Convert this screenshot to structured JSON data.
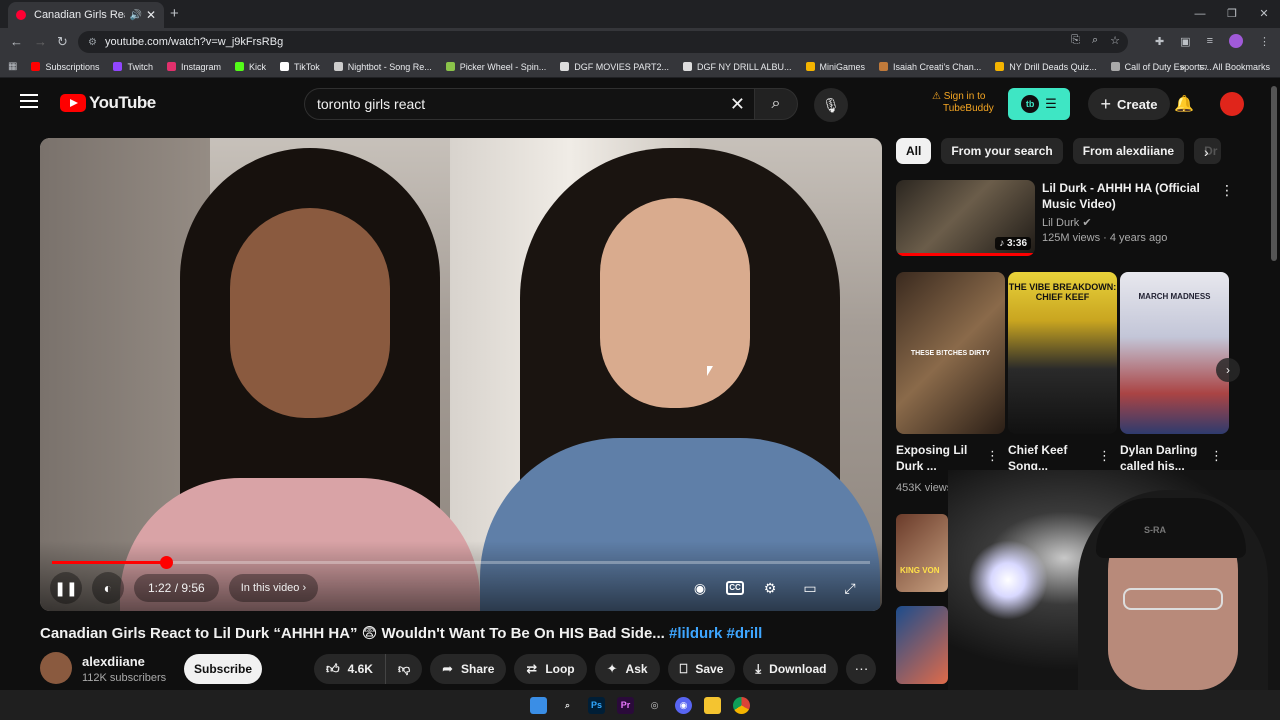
{
  "browser": {
    "tab_title": "Canadian Girls React to Lil Durk",
    "url": "youtube.com/watch?v=w_j9kFrsRBg",
    "bookmarks": [
      {
        "label": "Subscriptions",
        "color": "#ff0000"
      },
      {
        "label": "Twitch",
        "color": "#9146ff"
      },
      {
        "label": "Instagram",
        "color": "#e1306c"
      },
      {
        "label": "Kick",
        "color": "#53fc18"
      },
      {
        "label": "TikTok",
        "color": "#ffffff"
      },
      {
        "label": "Nightbot - Song Re...",
        "color": "#cccccc"
      },
      {
        "label": "Picker Wheel - Spin...",
        "color": "#8bc34a"
      },
      {
        "label": "DGF MOVIES PART2...",
        "color": "#dddddd"
      },
      {
        "label": "DGF NY DRILL ALBU...",
        "color": "#dddddd"
      },
      {
        "label": "MiniGames",
        "color": "#f4b400"
      },
      {
        "label": "Isaiah Creati's Chan...",
        "color": "#c07a3a"
      },
      {
        "label": "NY Drill Deads Quiz...",
        "color": "#f4b400"
      },
      {
        "label": "Call of Duty Esports...",
        "color": "#aaaaaa"
      }
    ],
    "all_bookmarks": "All Bookmarks"
  },
  "header": {
    "logo_text": "YouTube",
    "search_value": "toronto girls react",
    "tubebuddy_line1": "Sign in to",
    "tubebuddy_line2": "TubeBuddy",
    "tb_badge": "tb",
    "create_label": "Create"
  },
  "player": {
    "time": "1:22 / 9:56",
    "chapter": "In this video",
    "progress": 0.139,
    "buffered": 0.22
  },
  "video": {
    "title": "Canadian Girls React to Lil Durk “AHHH HA” 😨 Wouldn't Want To Be On HIS Bad Side...",
    "tags": "#lildurk #drill",
    "channel": "alexdiiane",
    "subscribers": "112K subscribers",
    "subscribe_label": "Subscribe",
    "likes": "4.6K",
    "share": "Share",
    "loop": "Loop",
    "ask": "Ask",
    "save": "Save",
    "download": "Download"
  },
  "sidebar": {
    "chips": [
      "All",
      "From your search",
      "From alexdiiane",
      "Dr"
    ],
    "rec": {
      "title": "Lil Durk - AHHH HA (Official Music Video)",
      "channel": "Lil Durk",
      "meta": "125M views · 4 years ago",
      "duration": "3:36"
    },
    "shorts": [
      {
        "title": "Exposing Lil Durk ...",
        "views": "453K views",
        "caption": "THESE B!TCHES DIRTY"
      },
      {
        "title": "Chief Keef Song...",
        "views": "",
        "caption": "THE VIBE BREAKDOWN: CHIEF KEEF"
      },
      {
        "title": "Dylan Darling called his...",
        "views": "",
        "caption": "MARCH MADNESS"
      }
    ],
    "more_caption": "KING VON"
  },
  "webcam": {
    "cap_text": "S-RA"
  }
}
